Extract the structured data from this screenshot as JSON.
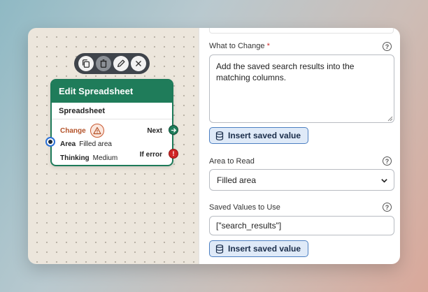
{
  "node": {
    "title": "Edit Spreadsheet",
    "subtitle": "Spreadsheet",
    "change_label": "Change",
    "area_label": "Area",
    "area_value": "Filled area",
    "thinking_label": "Thinking",
    "thinking_value": "Medium",
    "next_label": "Next",
    "error_label": "If error",
    "error_port_glyph": "!"
  },
  "toolbar": {
    "icons": [
      "copy-icon",
      "trash-icon",
      "pencil-icon",
      "close-icon"
    ]
  },
  "panel": {
    "change_field": {
      "label": "What to Change",
      "required_mark": "*",
      "value": "Add the saved search results into the matching columns."
    },
    "insert_label": "Insert saved value",
    "area_field": {
      "label": "Area to Read",
      "value": "Filled area"
    },
    "saved_field": {
      "label": "Saved Values to Use",
      "value": "[\"search_results\"]"
    },
    "help_glyph": "?"
  },
  "colors": {
    "node_header": "#1f7c5a",
    "error": "#d02424",
    "warning": "#c8562e",
    "button_bg": "#dfeaf8",
    "button_border": "#4c7fc1"
  }
}
